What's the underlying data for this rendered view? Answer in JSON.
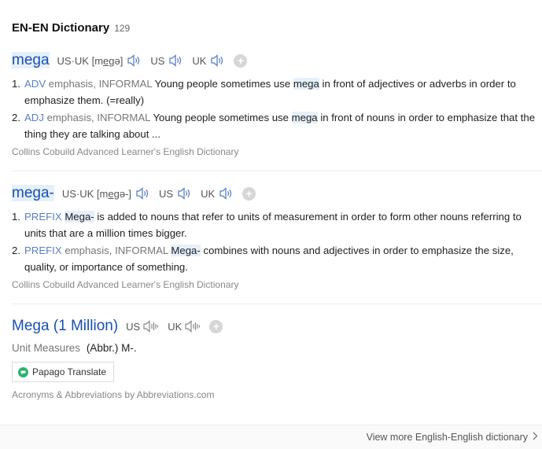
{
  "header": {
    "title": "EN-EN Dictionary",
    "count": "129"
  },
  "entries": [
    {
      "word": "mega",
      "pron_both_prefix": "US·UK [m",
      "pron_both_u": "e",
      "pron_both_mid": "g",
      "pron_both_suffix": "ə]",
      "us_label": "US",
      "uk_label": "UK",
      "defs": [
        {
          "num": "1.",
          "pos": "ADV",
          "reg": "emphasis, INFORMAL",
          "pre": "Young people sometimes use",
          "hl": "mega",
          "post": "in front of adjectives or adverbs in order to emphasize them. (=really)"
        },
        {
          "num": "2.",
          "pos": "ADJ",
          "reg": "emphasis, INFORMAL",
          "pre": "Young people sometimes use",
          "hl": "mega",
          "post": "in front of nouns in order to emphasize that the thing they are talking about ..."
        }
      ],
      "source": "Collins Cobuild Advanced Learner's English Dictionary"
    },
    {
      "word": "mega-",
      "pron_both_prefix": "US·UK [m",
      "pron_both_u": "e",
      "pron_both_mid": "gə-",
      "pron_both_suffix": "]",
      "us_label": "US",
      "uk_label": "UK",
      "defs": [
        {
          "num": "1.",
          "pos": "PREFIX",
          "reg": "",
          "pre": "",
          "hl": "Mega-",
          "post": "is added to nouns that refer to units of measurement in order to form other nouns referring to units that are a million times bigger."
        },
        {
          "num": "2.",
          "pos": "PREFIX",
          "reg": "emphasis, INFORMAL",
          "pre": "",
          "hl": "Mega-",
          "post": "combines with nouns and adjectives in order to emphasize the size, quality, or importance of something."
        }
      ],
      "source": "Collins Cobuild Advanced Learner's English Dictionary"
    },
    {
      "word": "Mega (1 Million)",
      "us_label": "US",
      "uk_label": "UK",
      "unit_category": "Unit Measures",
      "unit_value": "(Abbr.) M-.",
      "translate_label": "Papago Translate",
      "source": "Acronyms & Abbreviations by Abbreviations.com"
    }
  ],
  "footer": {
    "more_label": "View more English-English dictionary"
  },
  "colors": {
    "link": "#1a4fb3",
    "pos": "#5a7ec5",
    "highlight": "#e5f0fb",
    "papago": "#27b36b"
  },
  "icons": [
    "speaker-icon",
    "speaker-disabled-icon",
    "plus-icon",
    "papago-logo-icon",
    "chevron-right-icon"
  ]
}
